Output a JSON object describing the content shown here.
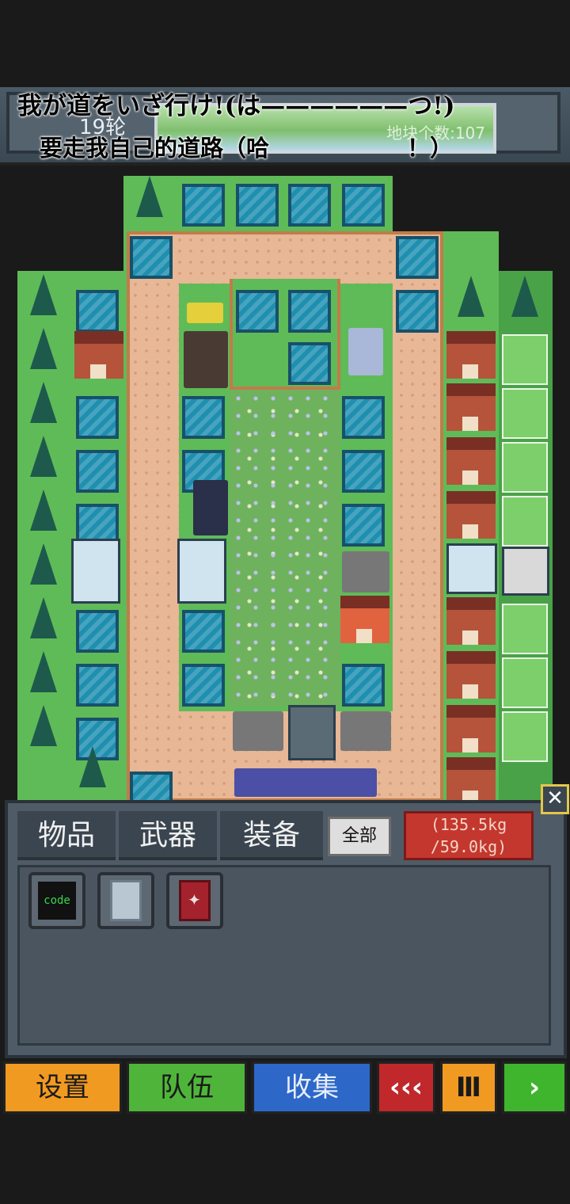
{
  "header": {
    "round_label": "19轮",
    "tile_count_label": "地块个数:107",
    "slogan_line1": "我が道をいざ行け!(は——————つ!)",
    "slogan_line2": "要走我自己的道路（哈　　　　　　！）"
  },
  "panel": {
    "tabs": [
      "物品",
      "武器",
      "装备"
    ],
    "filter_label": "全部",
    "weight_current": "(135.5kg",
    "weight_max": "/59.0kg)",
    "close_label": "✕",
    "items": [
      {
        "icon": "code-chip-icon",
        "label": "code"
      },
      {
        "icon": "gray-book-icon"
      },
      {
        "icon": "red-book-icon"
      }
    ]
  },
  "bottom_bar": {
    "settings": "设置",
    "team": "队伍",
    "collect": "收集",
    "rewind": "‹‹‹",
    "pause": "Ⅲ",
    "next": "›"
  },
  "colors": {
    "grass": "#5fbb57",
    "road": "#e7b796",
    "water": "#1f8fb0",
    "settings_button": "#f19a22",
    "team_button": "#4fb53a",
    "collect_button": "#2d67c8",
    "rewind_button": "#c0282b",
    "weight_badge": "#c4372e"
  }
}
